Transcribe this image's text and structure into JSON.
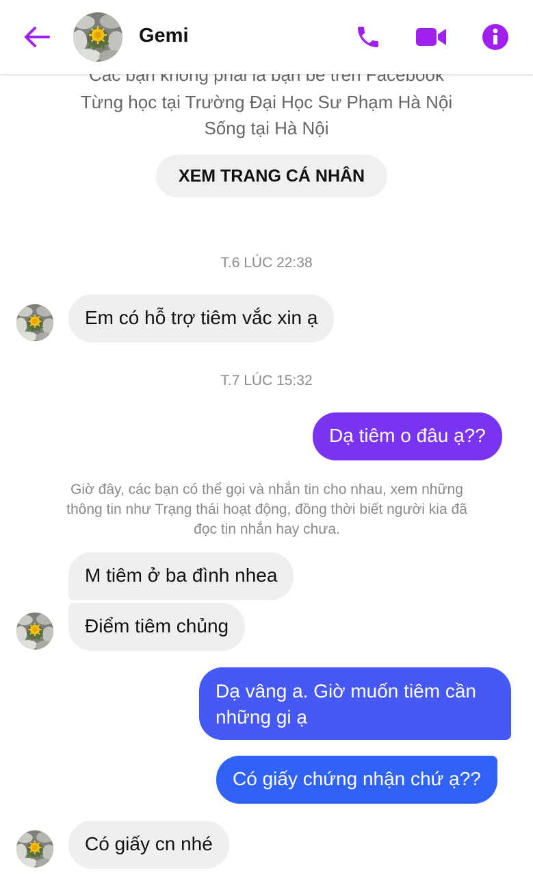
{
  "header": {
    "contact_name": "Gemi"
  },
  "colors": {
    "accent": "#a020f0",
    "outgoing_purple": "#7a33f0",
    "outgoing_blue": "#2f62f5",
    "incoming_bg": "#efefef"
  },
  "profile": {
    "line_friends": "Các bạn không phải là bạn bè trên Facebook",
    "line_school": "Từng học tại Trường Đại Học Sư Phạm Hà Nội",
    "line_city": "Sống tại Hà Nội",
    "view_profile_label": "XEM TRANG CÁ NHÂN"
  },
  "timestamps": {
    "first": "T.6 LÚC 22:38",
    "second": "T.7 LÚC 15:32"
  },
  "system_note": "Giờ đây, các bạn có thể gọi và nhắn tin cho nhau, xem những thông tin như Trạng thái hoạt động, đồng thời biết người kia đã đọc tin nhắn hay chưa.",
  "messages": [
    {
      "from": "them",
      "text": "Em có hỗ trợ tiêm vắc xin ạ"
    },
    {
      "from": "me",
      "text": "Dạ tiêm o đâu ạ??"
    },
    {
      "from": "them",
      "text": "M tiêm ở ba đình nhea"
    },
    {
      "from": "them",
      "text": "Điểm tiêm chủng"
    },
    {
      "from": "me",
      "text": "Dạ vâng a. Giờ muốn tiêm cần những gi ạ"
    },
    {
      "from": "me",
      "text": "Có giấy chứng nhận chứ ạ??"
    },
    {
      "from": "them",
      "text": "Có giấy cn nhé"
    }
  ],
  "icons": {
    "back": "arrow-left-icon",
    "call": "phone-icon",
    "video": "video-camera-icon",
    "info": "info-icon",
    "avatar": "dandelion-flower-avatar"
  }
}
